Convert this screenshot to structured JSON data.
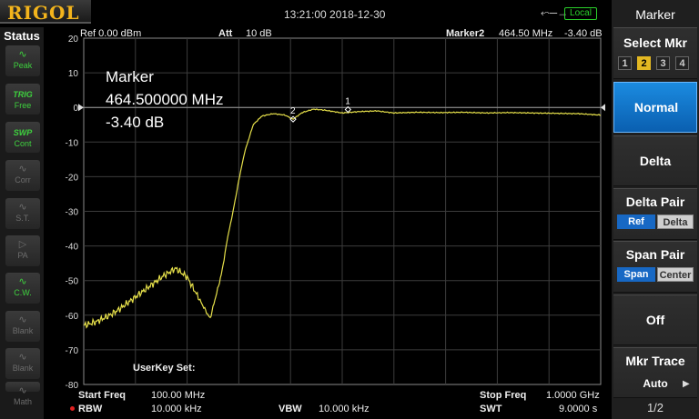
{
  "topbar": {
    "logo": "RIGOL",
    "datetime": "13:21:00 2018-12-30",
    "local_badge": "Local"
  },
  "status_panel": {
    "title": "Status",
    "items": [
      {
        "icon": "∿",
        "label": "Peak",
        "state": "active"
      },
      {
        "icon": "TRIG",
        "label": "Free",
        "state": "active"
      },
      {
        "icon": "SWP",
        "label": "Cont",
        "state": "active"
      },
      {
        "icon": "∿",
        "label": "Corr",
        "state": "inactive"
      },
      {
        "icon": "∿",
        "label": "S.T.",
        "state": "inactive"
      },
      {
        "icon": "▷",
        "label": "PA",
        "state": "inactive"
      },
      {
        "icon": "∿",
        "label": "C.W.",
        "state": "active"
      },
      {
        "icon": "∿",
        "label": "Blank",
        "state": "inactive"
      },
      {
        "icon": "∿",
        "label": "Blank",
        "state": "inactive"
      },
      {
        "icon": "∿",
        "label": "Math",
        "state": "inactive"
      }
    ]
  },
  "plot_header": {
    "ref": "Ref  0.00 dBm",
    "att_label": "Att",
    "att_value": "10 dB",
    "marker2_label": "Marker2",
    "marker2_freq": "464.50 MHz",
    "marker2_level": "-3.40 dB"
  },
  "marker_readout": {
    "title": "Marker",
    "freq": "464.500000 MHz",
    "level": "-3.40 dB"
  },
  "userkey": "UserKey Set:",
  "chart_data": {
    "type": "line",
    "title": "",
    "xlabel": "",
    "ylabel": "",
    "x_unit": "MHz",
    "y_unit": "dB",
    "xlim": [
      100,
      1000
    ],
    "ylim": [
      -80,
      20
    ],
    "yticks": [
      20,
      10,
      0,
      -10,
      -20,
      -30,
      -40,
      -50,
      -60,
      -70,
      -80
    ],
    "grid": true,
    "reference_level_db": 0,
    "trace_color": "#e6e04a",
    "trace": {
      "x": [
        100,
        120,
        140,
        160,
        180,
        200,
        220,
        240,
        260,
        280,
        300,
        320,
        340,
        350,
        360,
        370,
        380,
        395,
        410,
        430,
        450,
        464.5,
        480,
        500,
        520,
        550,
        580,
        610,
        640,
        680,
        720,
        760,
        800,
        840,
        880,
        920,
        960,
        1000
      ],
      "y": [
        -63,
        -62,
        -60.5,
        -58.5,
        -56,
        -53.5,
        -51,
        -48.5,
        -46.5,
        -49,
        -55,
        -61,
        -48,
        -38,
        -30,
        -21,
        -13,
        -5,
        -2.5,
        -1.8,
        -2.2,
        -3.4,
        -1.5,
        -0.5,
        -0.8,
        -1.6,
        -1.2,
        -1.0,
        -1.6,
        -1.4,
        -1.5,
        -1.4,
        -1.6,
        -1.5,
        -1.6,
        -1.7,
        -1.8,
        -2.2
      ]
    },
    "markers": [
      {
        "id": "1",
        "x": 560,
        "y": -0.6
      },
      {
        "id": "2",
        "x": 464.5,
        "y": -3.4,
        "active": true
      }
    ]
  },
  "bottom": {
    "start_freq_label": "Start Freq",
    "start_freq_value": "100.00 MHz",
    "rbw_label": "RBW",
    "rbw_value": "10.000 kHz",
    "vbw_label": "VBW",
    "vbw_value": "10.000 kHz",
    "stop_freq_label": "Stop Freq",
    "stop_freq_value": "1.0000 GHz",
    "swt_label": "SWT",
    "swt_value": "9.0000 s"
  },
  "menu": {
    "title": "Marker",
    "select_mkr": {
      "label": "Select Mkr",
      "options": [
        "1",
        "2",
        "3",
        "4"
      ],
      "selected": "2"
    },
    "normal": "Normal",
    "delta": "Delta",
    "delta_pair": {
      "label": "Delta Pair",
      "opt_a": "Ref",
      "opt_b": "Delta",
      "active": "Ref"
    },
    "span_pair": {
      "label": "Span Pair",
      "opt_a": "Span",
      "opt_b": "Center",
      "active": "Span"
    },
    "off": "Off",
    "mkr_trace": {
      "label": "Mkr Trace",
      "value": "Auto"
    },
    "page": "1/2"
  }
}
